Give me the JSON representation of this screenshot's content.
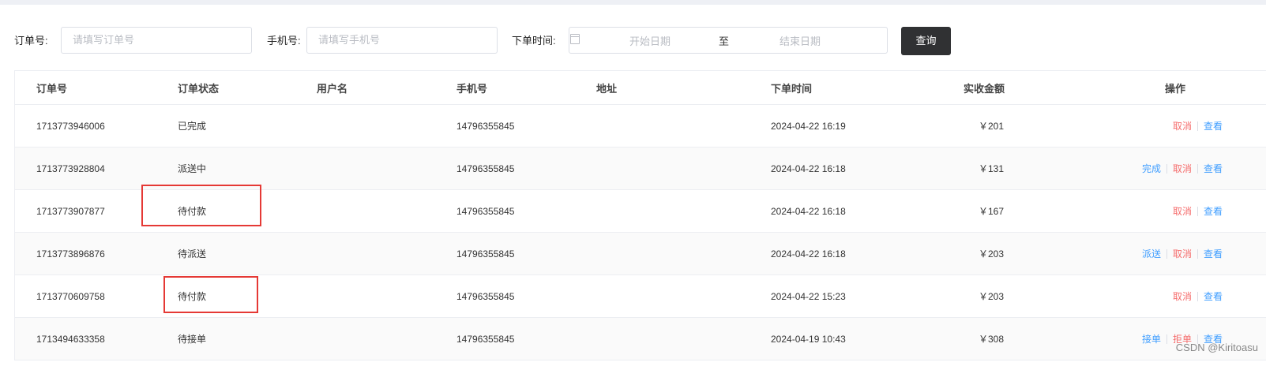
{
  "filters": {
    "order_no": {
      "label": "订单号:",
      "placeholder": "请填写订单号"
    },
    "phone": {
      "label": "手机号:",
      "placeholder": "请填写手机号"
    },
    "time": {
      "label": "下单时间:",
      "start_placeholder": "开始日期",
      "separator": "至",
      "end_placeholder": "结束日期"
    },
    "query_button": "查询"
  },
  "table": {
    "headers": {
      "order_no": "订单号",
      "status": "订单状态",
      "username": "用户名",
      "phone": "手机号",
      "address": "地址",
      "order_time": "下单时间",
      "amount": "实收金额",
      "actions": "操作"
    },
    "rows": [
      {
        "order_no": "1713773946006",
        "status": "已完成",
        "username": "",
        "phone": "14796355845",
        "address": "",
        "order_time": "2024-04-22 16:19",
        "amount": "￥201",
        "actions": [
          "取消",
          "查看"
        ]
      },
      {
        "order_no": "1713773928804",
        "status": "派送中",
        "username": "",
        "phone": "14796355845",
        "address": "",
        "order_time": "2024-04-22 16:18",
        "amount": "￥131",
        "actions": [
          "完成",
          "取消",
          "查看"
        ]
      },
      {
        "order_no": "1713773907877",
        "status": "待付款",
        "username": "",
        "phone": "14796355845",
        "address": "",
        "order_time": "2024-04-22 16:18",
        "amount": "￥167",
        "actions": [
          "取消",
          "查看"
        ]
      },
      {
        "order_no": "1713773896876",
        "status": "待派送",
        "username": "",
        "phone": "14796355845",
        "address": "",
        "order_time": "2024-04-22 16:18",
        "amount": "￥203",
        "actions": [
          "派送",
          "取消",
          "查看"
        ]
      },
      {
        "order_no": "1713770609758",
        "status": "待付款",
        "username": "",
        "phone": "14796355845",
        "address": "",
        "order_time": "2024-04-22 15:23",
        "amount": "￥203",
        "actions": [
          "取消",
          "查看"
        ]
      },
      {
        "order_no": "1713494633358",
        "status": "待接单",
        "username": "",
        "phone": "14796355845",
        "address": "",
        "order_time": "2024-04-19 10:43",
        "amount": "￥308",
        "actions": [
          "接单",
          "拒单",
          "查看"
        ]
      }
    ]
  },
  "watermark": "CSDN @Kiritoasu",
  "colors": {
    "link_blue": "#409eff",
    "danger_red": "#f56c6c",
    "highlight_red": "#e53935",
    "button_dark": "#303133"
  }
}
